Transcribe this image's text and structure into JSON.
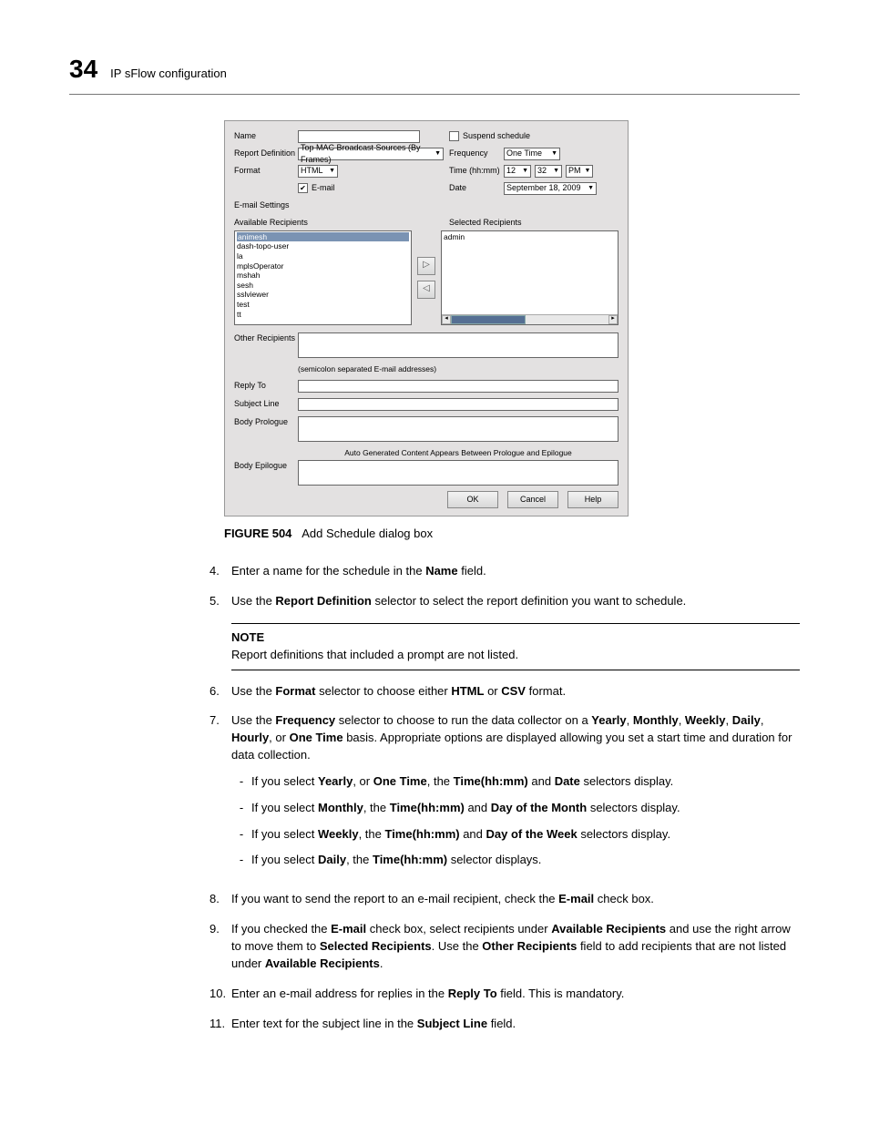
{
  "header": {
    "page_number": "34",
    "section_title": "IP sFlow configuration"
  },
  "dialog": {
    "labels": {
      "name": "Name",
      "report_definition": "Report Definition",
      "format": "Format",
      "email_settings": "E-mail Settings",
      "available_recipients": "Available Recipients",
      "selected_recipients": "Selected Recipients",
      "other_recipients": "Other Recipients",
      "other_recipients_hint": "(semicolon separated E-mail addresses)",
      "reply_to": "Reply To",
      "subject_line": "Subject Line",
      "body_prologue": "Body Prologue",
      "auto_gen_hint": "Auto Generated Content Appears Between Prologue and Epilogue",
      "body_epilogue": "Body Epilogue",
      "suspend_schedule": "Suspend schedule",
      "frequency": "Frequency",
      "time": "Time (hh:mm)",
      "date": "Date",
      "email": "E-mail"
    },
    "values": {
      "report_definition": "Top MAC Broadcast Sources (By Frames)",
      "format": "HTML",
      "email_checked": "✔",
      "frequency": "One Time",
      "time_hh": "12",
      "time_mm": "32",
      "time_ampm": "PM",
      "date": "September 18, 2009"
    },
    "available_list": [
      "animesh",
      "dash-topo-user",
      "la",
      "mplsOperator",
      "mshah",
      "sesh",
      "sslviewer",
      "test",
      "tt"
    ],
    "selected_list": [
      "admin"
    ],
    "buttons": {
      "ok": "OK",
      "cancel": "Cancel",
      "help": "Help"
    }
  },
  "figure_caption": {
    "label": "FIGURE 504",
    "text": "Add Schedule dialog box"
  },
  "steps": {
    "s4": {
      "num": "4.",
      "pre": "Enter a name for the schedule in the ",
      "b1": "Name",
      "post": " field."
    },
    "s5": {
      "num": "5.",
      "pre": "Use the ",
      "b1": "Report Definition",
      "post": " selector to select the report definition you want to schedule."
    },
    "note": {
      "heading": "NOTE",
      "text": "Report definitions that included a prompt are not listed."
    },
    "s6": {
      "num": "6.",
      "pre": "Use the ",
      "b1": "Format",
      "mid1": " selector to choose either ",
      "b2": "HTML",
      "mid2": " or ",
      "b3": "CSV",
      "post": " format."
    },
    "s7": {
      "num": "7.",
      "t0": "Use the ",
      "b1": "Frequency",
      "t1": " selector to choose to run the data collector on a ",
      "b2": "Yearly",
      "c1": ", ",
      "b3": "Monthly",
      "c2": ", ",
      "b4": "Weekly",
      "c3": ", ",
      "b5": "Daily",
      "c4": ", ",
      "b6": "Hourly",
      "c5": ", or ",
      "b7": "One Time",
      "t2": " basis. Appropriate options are displayed allowing you set a start time and duration for data collection.",
      "sub1": {
        "t0": "If you select ",
        "b1": "Yearly",
        "t1": ", or ",
        "b2": "One Time",
        "t2": ", the ",
        "b3": "Time(hh:mm)",
        "t3": " and ",
        "b4": "Date",
        "t4": " selectors display."
      },
      "sub2": {
        "t0": "If you select ",
        "b1": "Monthly",
        "t1": ", the ",
        "b2": "Time(hh:mm)",
        "t2": " and ",
        "b3": "Day of the Month",
        "t3": " selectors display."
      },
      "sub3": {
        "t0": "If you select ",
        "b1": "Weekly",
        "t1": ", the ",
        "b2": "Time(hh:mm)",
        "t2": " and ",
        "b3": "Day of the Week",
        "t3": " selectors display."
      },
      "sub4": {
        "t0": "If you select ",
        "b1": "Daily",
        "t1": ", the ",
        "b2": "Time(hh:mm)",
        "t2": " selector displays."
      }
    },
    "s8": {
      "num": "8.",
      "pre": "If you want to send the report to an e-mail recipient, check the ",
      "b1": "E-mail",
      "post": " check box."
    },
    "s9": {
      "num": "9.",
      "t0": "If you checked the ",
      "b1": "E-mail",
      "t1": " check box, select recipients under ",
      "b2": "Available Recipients",
      "t2": " and use the right arrow to move them to ",
      "b3": "Selected Recipients",
      "t3": ". Use the ",
      "b4": "Other Recipients",
      "t4": " field to add recipients that are not listed under ",
      "b5": "Available Recipients",
      "t5": "."
    },
    "s10": {
      "num": "10.",
      "pre": "Enter an e-mail address for replies in the ",
      "b1": "Reply To",
      "post": " field. This is mandatory."
    },
    "s11": {
      "num": "11.",
      "pre": "Enter text for the subject line in the ",
      "b1": "Subject Line",
      "post": " field."
    }
  }
}
